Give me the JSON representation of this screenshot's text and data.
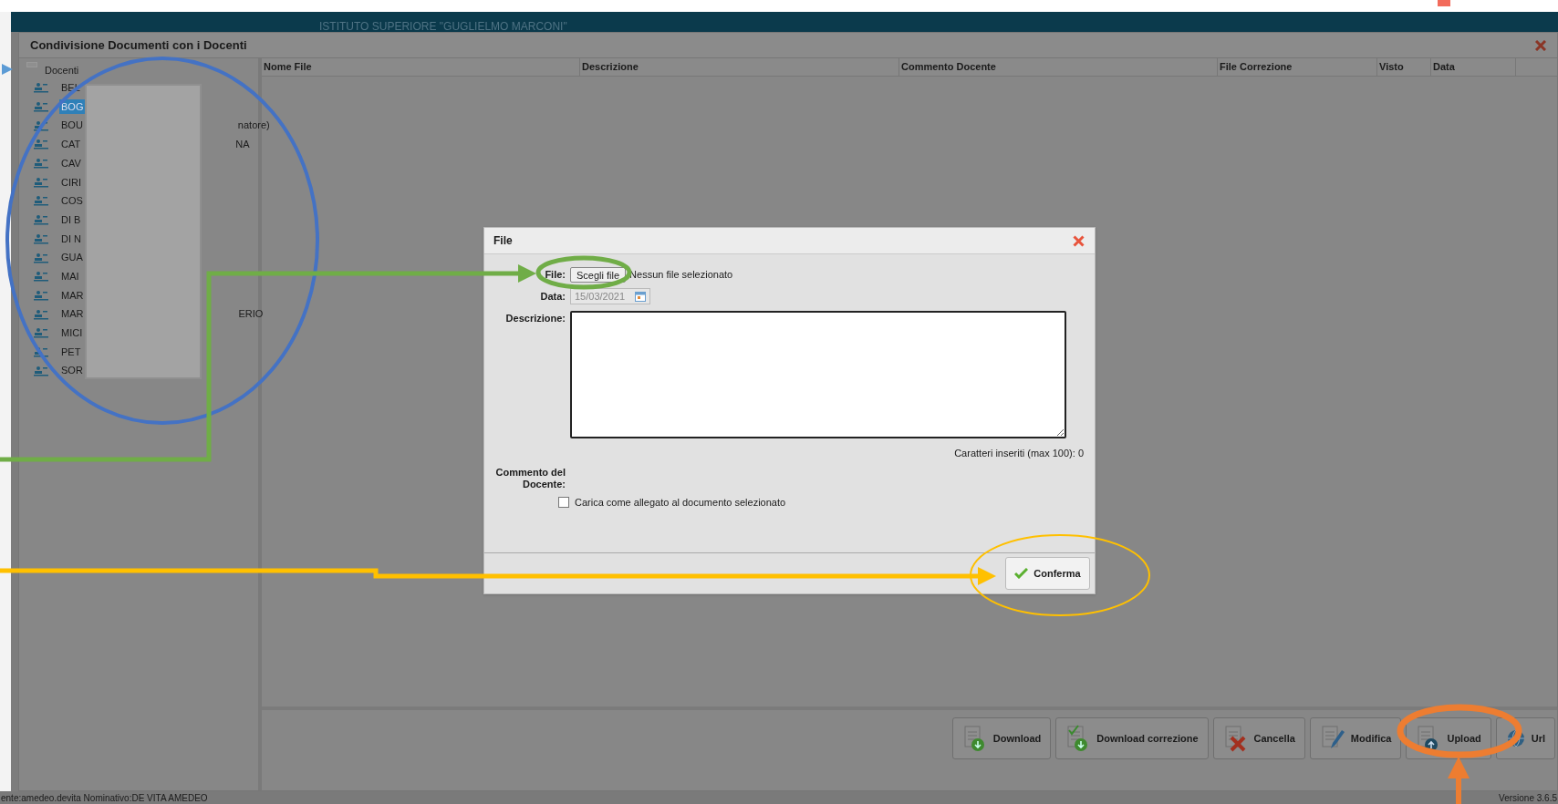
{
  "header": {
    "school": "ISTITUTO SUPERIORE \"GUGLIELMO MARCONI\""
  },
  "window": {
    "title": "Condivisione Documenti con i Docenti"
  },
  "tree": {
    "root": "Docenti",
    "items": [
      {
        "name": "BEL",
        "selected": false
      },
      {
        "name": "BOG",
        "selected": true
      },
      {
        "name": "BOU",
        "tail": "natore)",
        "selected": false
      },
      {
        "name": "CAT",
        "tail": "NA",
        "selected": false
      },
      {
        "name": "CAV",
        "selected": false
      },
      {
        "name": "CIRI",
        "selected": false
      },
      {
        "name": "COS",
        "selected": false
      },
      {
        "name": "DI B",
        "selected": false
      },
      {
        "name": "DI N",
        "selected": false
      },
      {
        "name": "GUA",
        "selected": false
      },
      {
        "name": "MAI",
        "selected": false
      },
      {
        "name": "MAR",
        "selected": false
      },
      {
        "name": "MAR",
        "tail": "ERIO",
        "selected": false
      },
      {
        "name": "MICI",
        "selected": false
      },
      {
        "name": "PET",
        "selected": false
      },
      {
        "name": "SOR",
        "selected": false
      }
    ]
  },
  "table": {
    "columns": [
      "Nome File",
      "Descrizione",
      "Commento Docente",
      "File Correzione",
      "Visto",
      "Data"
    ]
  },
  "toolbar": {
    "buttons": [
      {
        "label": "Download",
        "kind": "download"
      },
      {
        "label": "Download correzione",
        "kind": "download_correction"
      },
      {
        "label": "Cancella",
        "kind": "delete"
      },
      {
        "label": "Modifica",
        "kind": "edit"
      },
      {
        "label": "Upload",
        "kind": "upload"
      },
      {
        "label": "Url",
        "kind": "url"
      }
    ]
  },
  "dialog": {
    "title": "File",
    "file": {
      "label": "File:",
      "button": "Scegli file",
      "status": "Nessun file selezionato"
    },
    "date": {
      "label": "Data:",
      "value": "15/03/2021",
      "disabled": true
    },
    "description": {
      "label": "Descrizione:",
      "counter": "Caratteri inseriti (max 100): 0"
    },
    "comment_label": "Commento del Docente:",
    "attach": {
      "label": "Carica come allegato al documento selezionato",
      "checked": false
    },
    "confirm": "Conferma"
  },
  "status_bar": {
    "user": "ente:amedeo.devita Nominativo:DE VITA AMEDEO",
    "version": "Versione 3.6.5"
  }
}
